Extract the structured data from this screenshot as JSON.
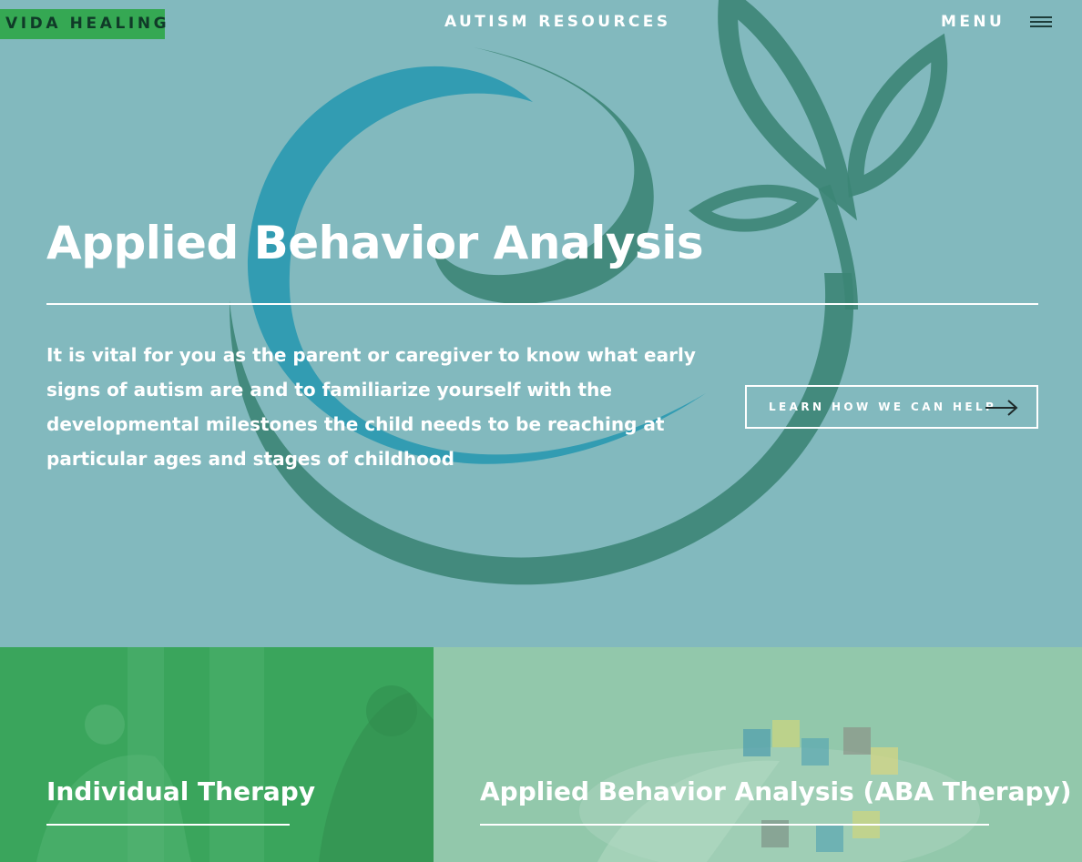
{
  "brand": {
    "logo_text": "VIDA HEALING"
  },
  "nav": {
    "center_link": "AUTISM RESOURCES",
    "menu_label": "MENU",
    "menu_icon": "hamburger-icon"
  },
  "hero": {
    "title": "Applied Behavior Analysis",
    "description": "It is vital for you as the parent or caregiver to know what early signs of autism are and to familiarize yourself with the developmental milestones the child needs to be reaching at particular ages and stages of childhood",
    "cta_label": "LEARN HOW WE CAN HELP",
    "cta_icon": "arrow-right-icon"
  },
  "cards": [
    {
      "title": "Individual Therapy",
      "image": "therapy-session-photo"
    },
    {
      "title": "Applied Behavior Analysis (ABA Therapy)",
      "image": "puzzle-pieces-photo"
    }
  ],
  "colors": {
    "hero_bg": "#82b9be",
    "logo_bg": "#35a853",
    "swirl_blue": "#2497b0",
    "swirl_green": "#3c8576",
    "card_left_bg": "#3aa55c",
    "card_right_bg": "#92c8ab"
  }
}
